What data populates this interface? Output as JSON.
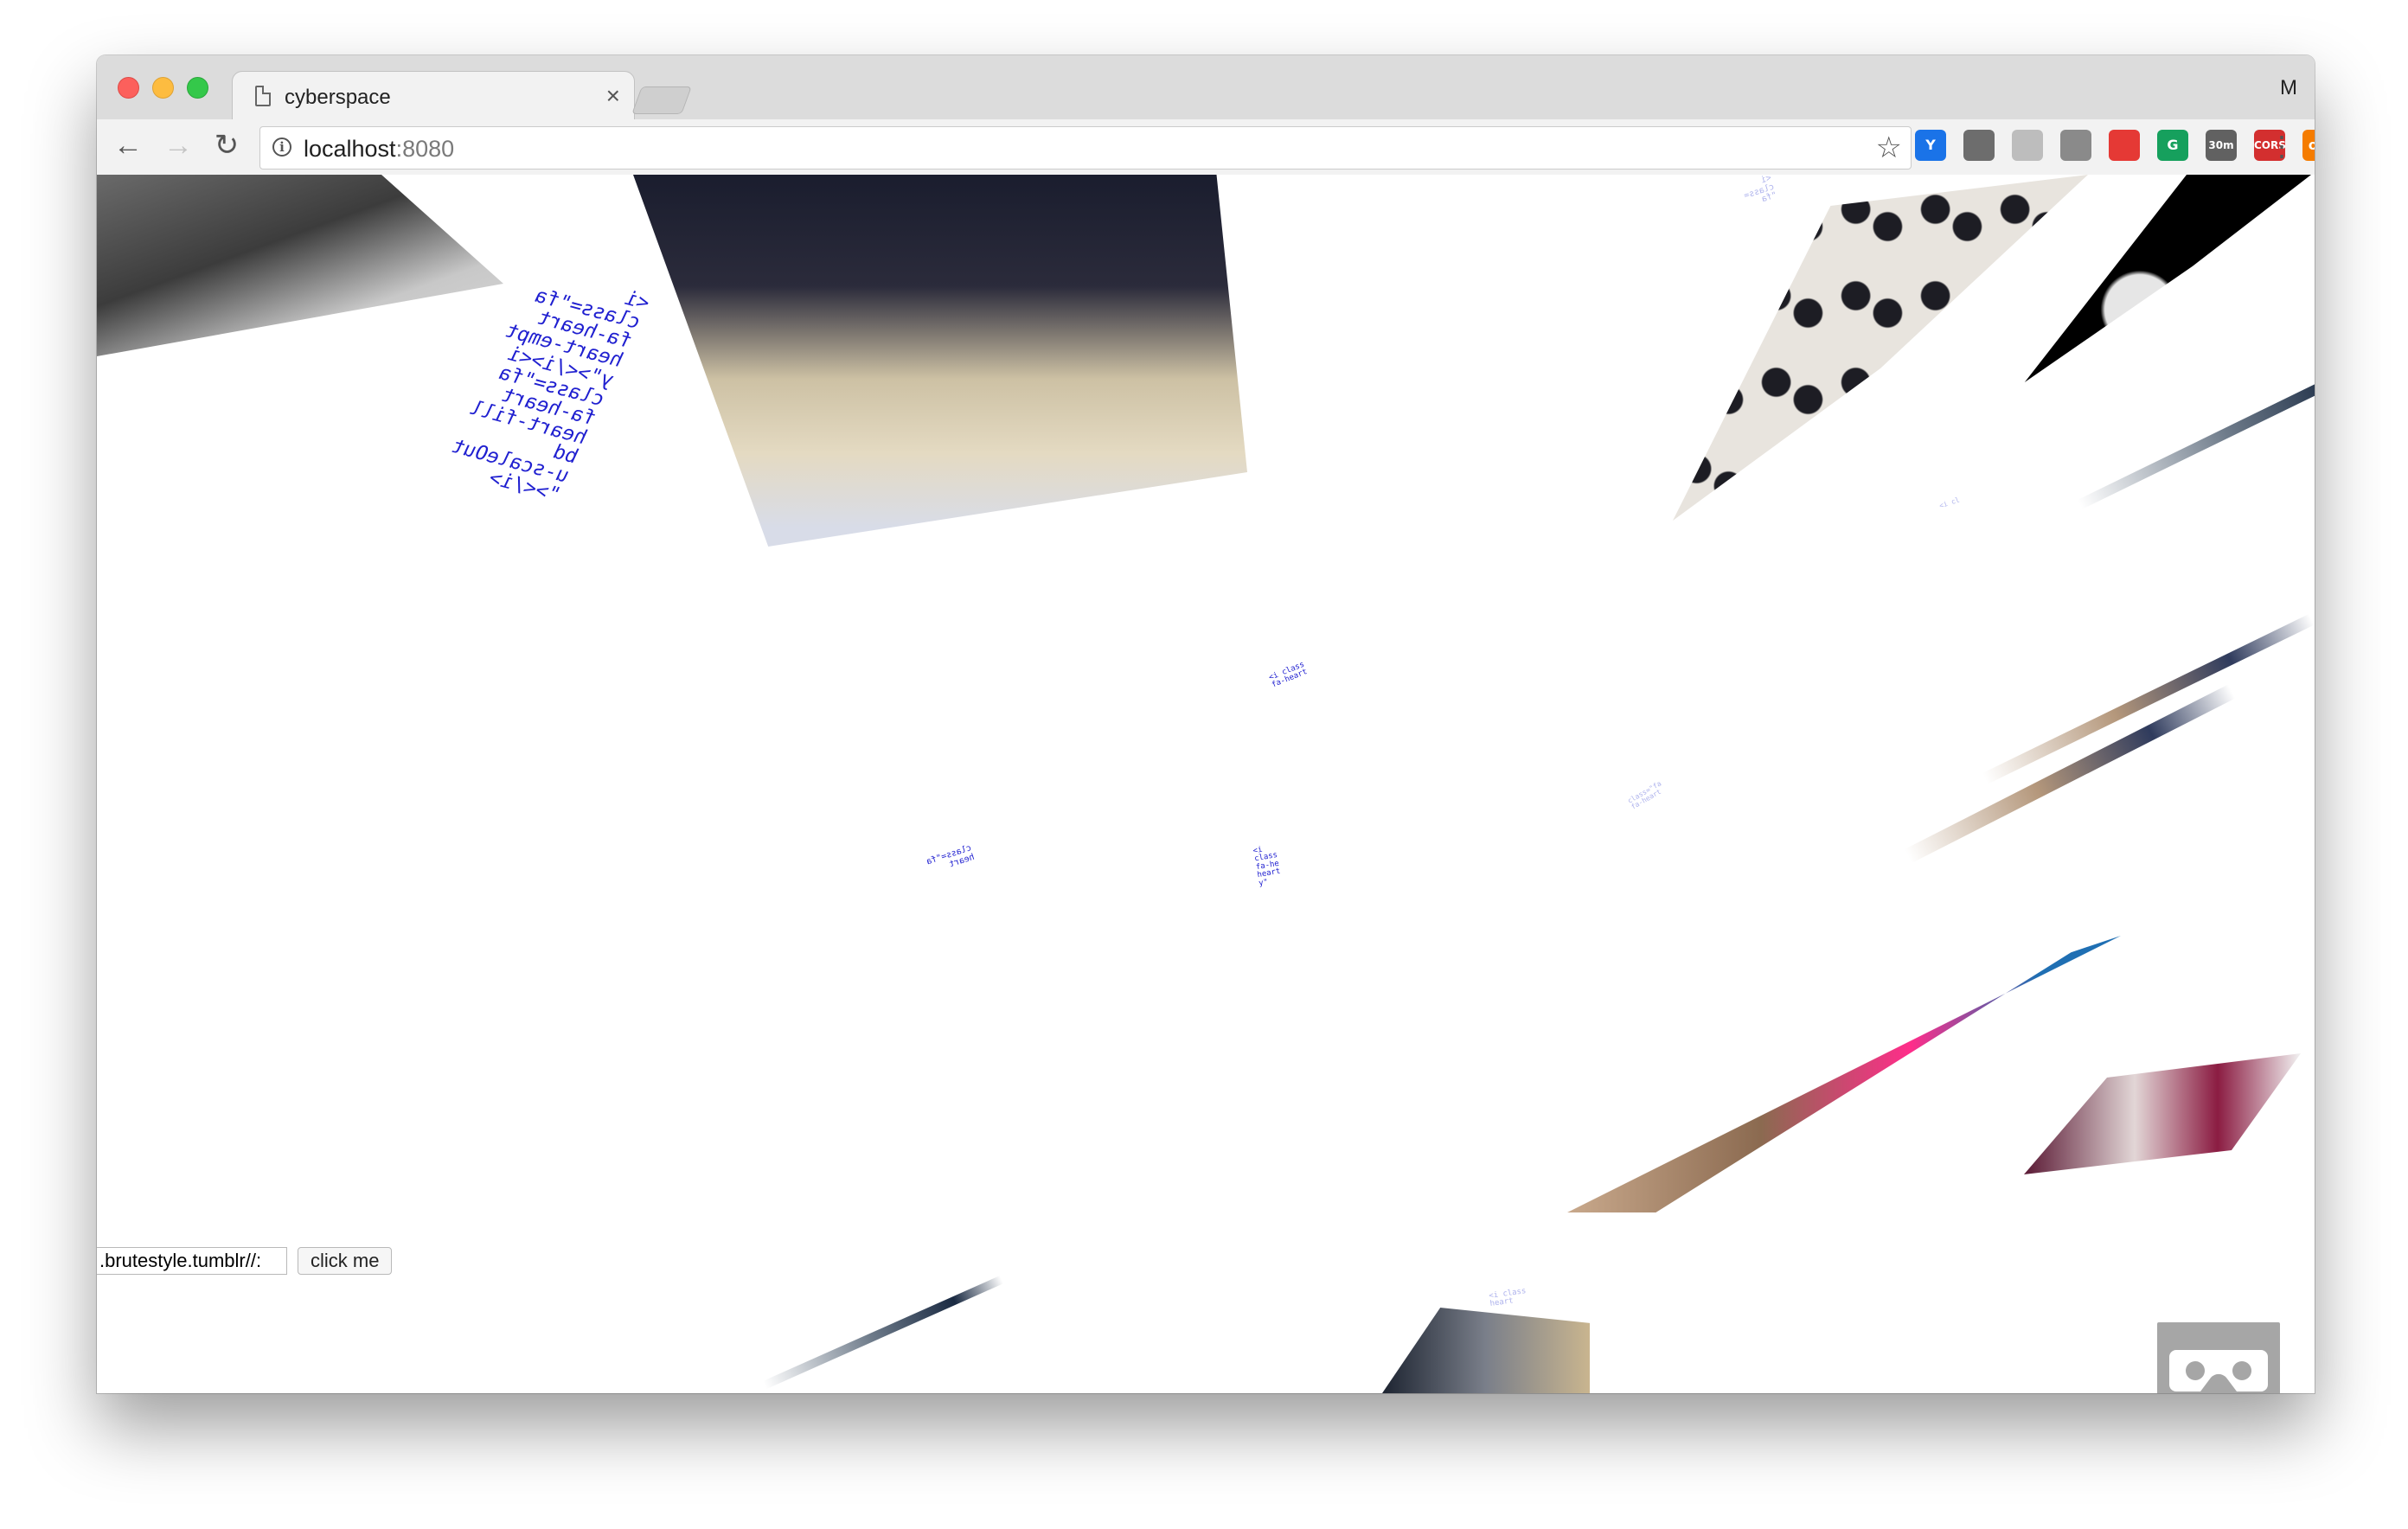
{
  "tab": {
    "title": "cyberspace",
    "close_glyph": "×"
  },
  "profile_initial": "M",
  "address": {
    "host": "localhost",
    "port": ":8080"
  },
  "extensions": [
    {
      "name": "y-extension-icon",
      "label": "Y",
      "color": "#1a73e8"
    },
    {
      "name": "cast-icon",
      "label": "",
      "color": "#6d6d6d"
    },
    {
      "name": "drive-icon",
      "label": "",
      "color": "#bdbdbd"
    },
    {
      "name": "film-reel-icon",
      "label": "",
      "color": "#8a8a8a"
    },
    {
      "name": "adblock-icon",
      "label": "",
      "color": "#e53935"
    },
    {
      "name": "grammarly-icon",
      "label": "G",
      "color": "#16a05d"
    },
    {
      "name": "timer-icon",
      "label": "30m",
      "color": "#616161"
    },
    {
      "name": "cors-icon",
      "label": "CORS",
      "color": "#d32f2f"
    },
    {
      "name": "on-toggle-icon",
      "label": "on",
      "color": "#f57c00"
    }
  ],
  "scene": {
    "code_block": "<i\nclass=\"fa\nfa-heart\nheart-empt\ny\"></i><i\nclass=\"fa\nfa-heart\nheart-fill\nbd\nu-scaleOut\n\"></i>",
    "url_input_value": "://brutestyle.tumblr.",
    "click_button_label": "click me"
  }
}
